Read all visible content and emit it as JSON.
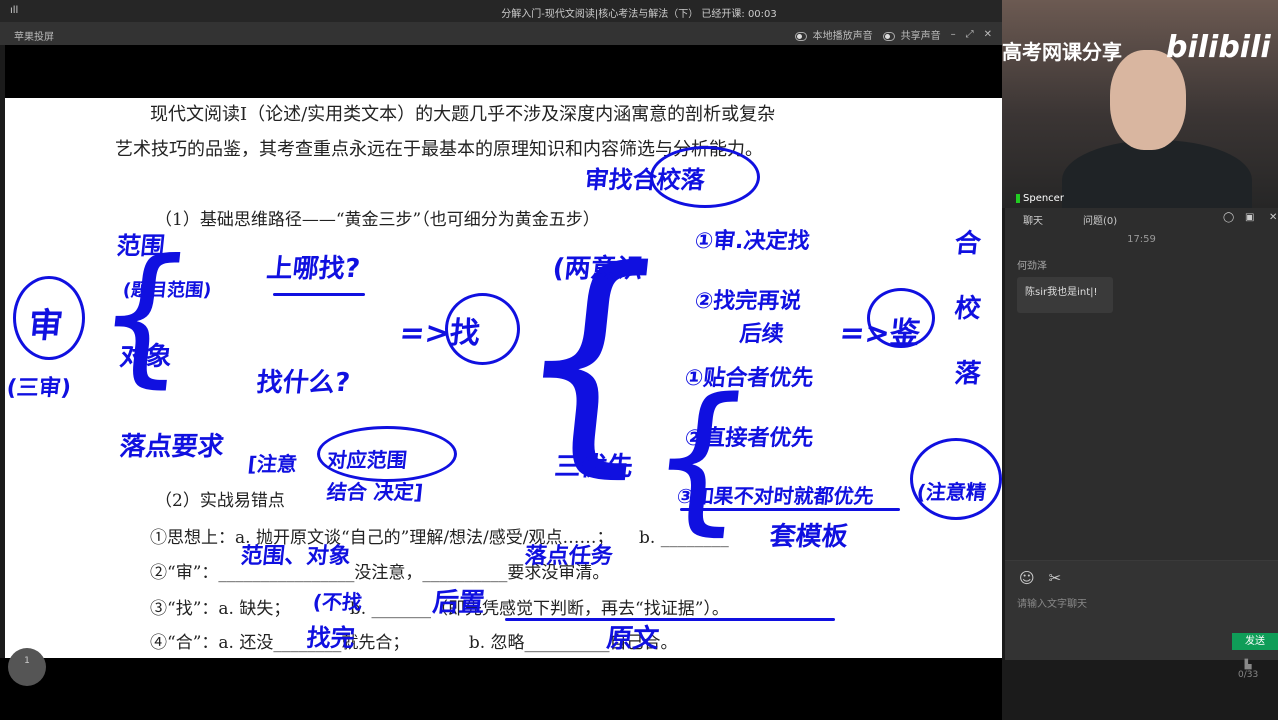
{
  "topbar": {
    "title": "分解入门-现代文阅读|核心考法与解法（下）  已经开课: 00:03",
    "signal": "ıll",
    "controls": [
      "🎙▾",
      "◉▾",
      "▮",
      "⠿",
      "–",
      "⤢",
      "✕"
    ]
  },
  "subbar": {
    "name": "苹果投屏",
    "local_audio": "本地播放声音",
    "share_audio": "共享声音",
    "controls": [
      "–",
      "⤢",
      "✕"
    ]
  },
  "document": {
    "para1_line1": "现代文阅读Ⅰ（论述/实用类文本）的大题几乎不涉及深度内涵寓意的剖析或复杂",
    "para1_line2": "艺术技巧的品鉴，其考查重点永远在于最基本的原理知识和内容筛选与分析能力。",
    "heading1": "（1）基础思维路径——“黄金三步”（也可细分为黄金五步）",
    "heading2": "（2）实战易错点",
    "item1": "①思想上：a. 抛开原文谈“自己的”理解/想法/感受/观点……；　　b. ________",
    "item2": "②“审”：________________没注意，__________要求没审清。",
    "item3": "③“找”：a. 缺失；　　　　b. _______（即先凭感觉下判断，再去“找证据”）。",
    "item4": "④“合”：a. 还没________就先合；　　　　b. 忽略__________自己合。"
  },
  "annotations": [
    "审找合校落",
    "范围",
    "(题目范围)",
    "上哪找?",
    "审",
    "(三审)",
    "对象",
    "落点要求",
    "找什么?",
    "[注意",
    "对应范围",
    "结合 决定]",
    "=>找",
    "(两意识",
    "①审.决定找",
    "②找完再说",
    "后续",
    "=>鉴",
    "合",
    "校",
    "落",
    "①贴合者优先",
    "②直接者优先",
    "③如果不对时就都优先",
    "(注意精",
    "三优先",
    "套模板",
    "范围、对象",
    "落点任务",
    "(不找",
    "后置",
    "找完",
    "原文"
  ],
  "video": {
    "brand": "高考网课分享",
    "logo": "bilibili",
    "speaker": "Spencer"
  },
  "chat": {
    "tab_chat": "聊天",
    "tab_questions": "问题(0)",
    "time": "17:59",
    "sender": "何劲泽",
    "message": "陈sir我也是int|!",
    "placeholder": "请输入文字聊天",
    "send": "发送",
    "emoji_icon": "☺",
    "scissors_icon": "✂"
  },
  "pager": {
    "pages": "0/33"
  },
  "fab": {
    "label": "1"
  }
}
